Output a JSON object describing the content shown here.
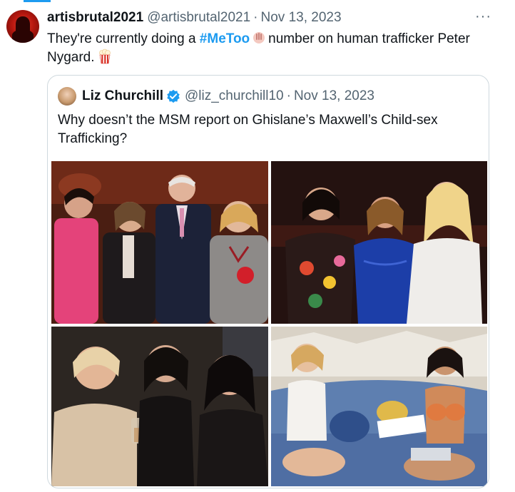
{
  "tweet": {
    "author_name": "artisbrutal2021",
    "handle": "@artisbrutal2021",
    "separator": "·",
    "date": "Nov 13, 2023",
    "more_icon": "···",
    "text_before": "They're currently doing a",
    "hashtag": "#MeToo",
    "text_after": "number on human trafficker Peter Nygard."
  },
  "quote": {
    "author_name": "Liz Churchill",
    "handle": "@liz_churchill10",
    "separator": "·",
    "date": "Nov 13, 2023",
    "text": "Why doesn’t the MSM report on Ghislane’s Maxwell’s Child-sex Trafficking?",
    "verified": true
  },
  "icons": [
    "avatar",
    "raised-hand-emoji",
    "popcorn-emoji",
    "verified-badge-icon",
    "more-options-icon"
  ],
  "colors": {
    "accent": "#1d9bf0",
    "text": "#0f1419",
    "muted": "#536471",
    "border": "#cfd9de"
  }
}
